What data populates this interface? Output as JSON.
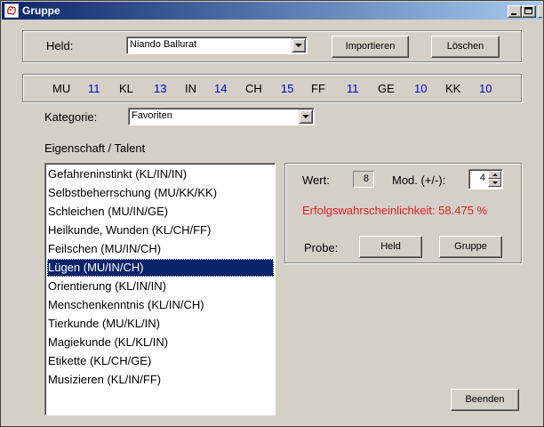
{
  "window": {
    "title": "Gruppe"
  },
  "hero": {
    "label": "Held:",
    "selected": "Niando Ballurat",
    "import_label": "Importieren",
    "delete_label": "Löschen"
  },
  "attributes": [
    {
      "name": "MU",
      "value": "11"
    },
    {
      "name": "KL",
      "value": "13"
    },
    {
      "name": "IN",
      "value": "14"
    },
    {
      "name": "CH",
      "value": "15"
    },
    {
      "name": "FF",
      "value": "11"
    },
    {
      "name": "GE",
      "value": "10"
    },
    {
      "name": "KK",
      "value": "10"
    }
  ],
  "category": {
    "label": "Kategorie:",
    "selected": "Favoriten"
  },
  "talents": {
    "heading": "Eigenschaft / Talent",
    "selected_index": 5,
    "items": [
      "Gefahreninstinkt (KL/IN/IN)",
      "Selbstbeherrschung (MU/KK/KK)",
      "Schleichen (MU/IN/GE)",
      "Heilkunde, Wunden (KL/CH/FF)",
      "Feilschen (MU/IN/CH)",
      "Lügen (MU/IN/CH)",
      "Orientierung (KL/IN/IN)",
      "Menschenkenntnis (KL/IN/CH)",
      "Tierkunde (MU/KL/IN)",
      "Magiekunde (KL/KL/IN)",
      "Etikette (KL/CH/GE)",
      "Musizieren (KL/IN/FF)"
    ]
  },
  "details": {
    "value_label": "Wert:",
    "value": "8",
    "mod_label": "Mod. (+/-):",
    "mod_value": "4",
    "probability_text": "Erfolgswahrscheinlichkeit: 58.475 %",
    "probability_color": "#e02020",
    "probe_label": "Probe:",
    "hero_button": "Held",
    "group_button": "Gruppe"
  },
  "footer": {
    "close_label": "Beenden"
  },
  "colors": {
    "attribute_value": "#0000cc",
    "selection": "#0a246a",
    "title_gradient_start": "#0a246a",
    "title_gradient_end": "#a6caf0"
  }
}
